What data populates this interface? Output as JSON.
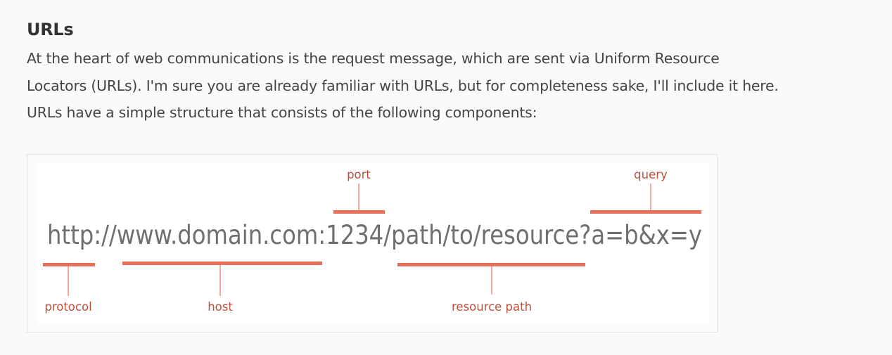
{
  "section": {
    "title": "URLs",
    "paragraph_lines": [
      "At the heart of web communications is the request message, which are sent via Uniform Resource",
      "Locators (URLs). I'm sure you are already familiar with URLs, but for completeness sake, I'll include it here.",
      "URLs have a simple structure that consists of the following components:"
    ]
  },
  "diagram": {
    "url": "http://www.domain.com:1234/path/to/resource?a=b&x=y",
    "accent_color": "#e8705a",
    "label_color": "#c0503a",
    "url_color": "#6f6f6f",
    "components": {
      "port": "port",
      "query": "query",
      "protocol": "protocol",
      "host": "host",
      "resource_path": "resource path"
    }
  }
}
